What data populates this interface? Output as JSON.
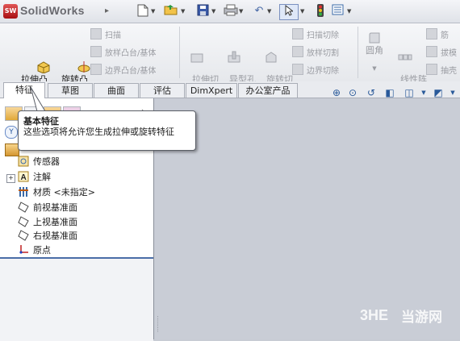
{
  "app": {
    "name": "SolidWorks",
    "badge": "SW"
  },
  "quick_access": [
    "new-icon",
    "open-icon",
    "save-icon",
    "print-icon",
    "undo-icon",
    "select-icon",
    "rebuild-icon",
    "options-icon"
  ],
  "ribbon": {
    "extrude_boss": "拉伸凸\n台/基体",
    "revolve_boss": "旋转凸\n台/基体",
    "sweep": "扫描",
    "loft": "放样凸台/基体",
    "boundary": "边界凸台/基体",
    "extrude_cut": "拉伸切\n除",
    "hole_wizard": "异型孔\n向导",
    "revolve_cut": "旋转切\n除",
    "swept_cut": "扫描切除",
    "lofted_cut": "放样切割",
    "boundary_cut": "边界切除",
    "fillet": "圆角",
    "linear_pattern": "线性阵\n列",
    "rib": "筋",
    "draft": "拔模",
    "shell": "抽壳"
  },
  "tabs": [
    "特征",
    "草图",
    "曲面",
    "评估",
    "DimXpert",
    "办公室产品"
  ],
  "active_tab": "特征",
  "tree": {
    "items": [
      {
        "label": "传感器",
        "icon": "sensor-icon",
        "expandable": false
      },
      {
        "label": "注解",
        "icon": "annotation-icon",
        "expandable": true
      },
      {
        "label": "材质 <未指定>",
        "icon": "material-icon",
        "expandable": false
      },
      {
        "label": "前视基准面",
        "icon": "plane-icon",
        "expandable": false
      },
      {
        "label": "上视基准面",
        "icon": "plane-icon",
        "expandable": false
      },
      {
        "label": "右视基准面",
        "icon": "plane-icon",
        "expandable": false
      },
      {
        "label": "原点",
        "icon": "origin-icon",
        "expandable": false
      }
    ]
  },
  "tooltip": {
    "title": "基本特征",
    "body": "这些选项将允许您生成拉伸或旋转特征"
  },
  "watermark": {
    "brand": "3HE",
    "text": "当游网"
  },
  "colors": {
    "accent": "#4a6da8",
    "viewport": "#c9cdd6",
    "panel": "#ffffff"
  }
}
